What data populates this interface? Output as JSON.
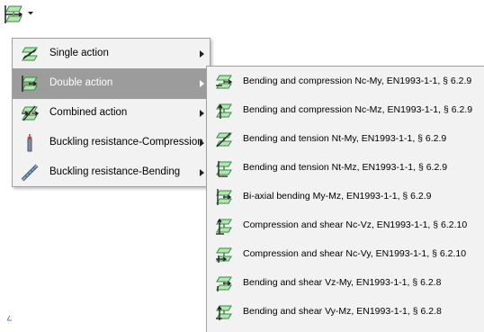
{
  "toolbar": {
    "button_icon": "section-check-icon",
    "dropdown_icon": "dropdown-arrow-icon"
  },
  "menu_main": {
    "items": [
      {
        "label": "Single action",
        "icon": "single-action-icon",
        "has_submenu": true,
        "highlighted": false
      },
      {
        "label": "Double action",
        "icon": "double-action-icon",
        "has_submenu": true,
        "highlighted": true
      },
      {
        "label": "Combined action",
        "icon": "combined-action-icon",
        "has_submenu": true,
        "highlighted": false
      },
      {
        "label": "Buckling resistance-Compression",
        "icon": "buckling-compression-icon",
        "has_submenu": true,
        "highlighted": false
      },
      {
        "label": "Buckling resistance-Bending",
        "icon": "buckling-bending-icon",
        "has_submenu": true,
        "highlighted": false
      }
    ]
  },
  "menu_double_action": {
    "items": [
      {
        "label": "Bending and compression Nc-My,  EN1993-1-1, § 6.2.9",
        "icon": "nc-my-icon"
      },
      {
        "label": "Bending and compression Nc-Mz,  EN1993-1-1, § 6.2.9",
        "icon": "nc-mz-icon"
      },
      {
        "label": "Bending and tension Nt-My,  EN1993-1-1, § 6.2.9",
        "icon": "nt-my-icon"
      },
      {
        "label": "Bending and tension Nt-Mz,  EN1993-1-1, § 6.2.9",
        "icon": "nt-mz-icon"
      },
      {
        "label": "Bi-axial bending My-Mz,  EN1993-1-1, § 6.2.9",
        "icon": "my-mz-icon"
      },
      {
        "label": "Compression and shear Nc-Vz,  EN1993-1-1, § 6.2.10",
        "icon": "nc-vz-icon"
      },
      {
        "label": "Compression and shear Nc-Vy,  EN1993-1-1, § 6.2.10",
        "icon": "nc-vy-icon"
      },
      {
        "label": "Bending and shear Vz-My,  EN1993-1-1, § 6.2.8",
        "icon": "vz-my-icon"
      },
      {
        "label": "Bending and shear Vy-Mz,  EN1993-1-1, § 6.2.8",
        "icon": "vy-mz-icon"
      }
    ]
  },
  "colors": {
    "menu_bg": "#f2f2f2",
    "highlight_bg": "#9c9c9c",
    "icon_green": "#3aa04a",
    "icon_dark": "#1c1c1c"
  }
}
